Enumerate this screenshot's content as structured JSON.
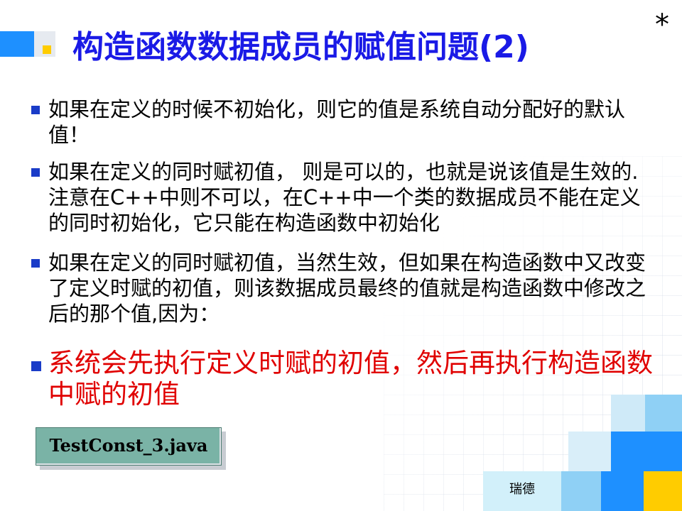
{
  "slide": {
    "title": "构造函数数据成员的赋值问题(2)",
    "corner_mark": "*",
    "bullets": [
      {
        "text": "如果在定义的时候不初始化，则它的值是系统自动分配好的默认值！"
      },
      {
        "text": "如果在定义的同时赋初值， 则是可以的，也就是说该值是生效的.注意在C++中则不可以，在C++中一个类的数据成员不能在定义的同时初始化，它只能在构造函数中初始化"
      },
      {
        "text": "如果在定义的同时赋初值，当然生效，但如果在构造函数中又改变了定义时赋的初值，则该数据成员最终的值就是构造函数中修改之后的那个值,因为："
      },
      {
        "text": "系统会先执行定义时赋的初值，然后再执行构造函数中赋的初值",
        "highlight": true
      }
    ],
    "file_label": "TestConst_3.java",
    "footer_label": "瑞德"
  },
  "colors": {
    "title": "#1a1ae6",
    "bullet_marker": "#1a3cc8",
    "highlight_text": "#e00000",
    "file_box": "#7ab3a6",
    "accent_blue": "#1e90ff",
    "accent_light_blue": "#8fd0f5",
    "accent_yellow": "#ffcc00"
  }
}
